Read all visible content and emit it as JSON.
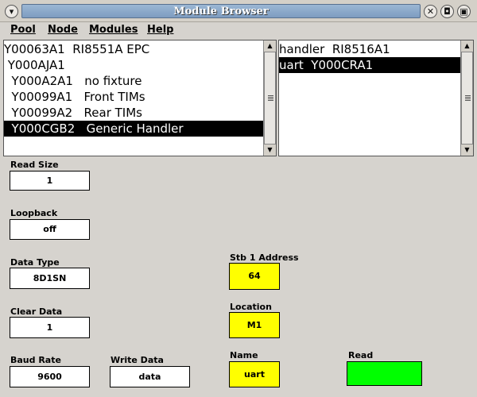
{
  "window": {
    "title": "Module Browser"
  },
  "icons": {
    "window_menu": "chevron-down-icon",
    "close": "close-icon",
    "restore": "restore-icon",
    "maximize": "maximize-icon"
  },
  "menubar": {
    "items": [
      "Pool",
      "Node",
      "Modules",
      "Help"
    ]
  },
  "left_list": {
    "rows": [
      "Y00063A1  RI8551A EPC",
      " Y000AJA1",
      "  Y000A2A1   no fixture",
      "  Y00099A1   Front TIMs",
      "  Y00099A2   Rear TIMs",
      "  Y000CGB2   Generic Handler"
    ],
    "selected_index": 5
  },
  "right_list": {
    "rows": [
      "handler  RI8516A1",
      "uart  Y000CRA1"
    ],
    "selected_index": 1
  },
  "fields": {
    "read_size": {
      "label": "Read Size",
      "value": "1"
    },
    "loopback": {
      "label": "Loopback",
      "value": "off"
    },
    "data_type": {
      "label": "Data Type",
      "value": "8D1SN"
    },
    "clear_data": {
      "label": "Clear Data",
      "value": "1"
    },
    "baud_rate": {
      "label": "Baud Rate",
      "value": "9600"
    },
    "write_data": {
      "label": "Write Data",
      "value": "data"
    },
    "stb1_address": {
      "label": "Stb 1 Address",
      "value": "64",
      "color": "#ffff00"
    },
    "location": {
      "label": "Location",
      "value": "M1",
      "color": "#ffff00"
    },
    "name": {
      "label": "Name",
      "value": "uart",
      "color": "#ffff00"
    },
    "read": {
      "label": "Read",
      "value": "",
      "color": "#00ff00"
    }
  }
}
